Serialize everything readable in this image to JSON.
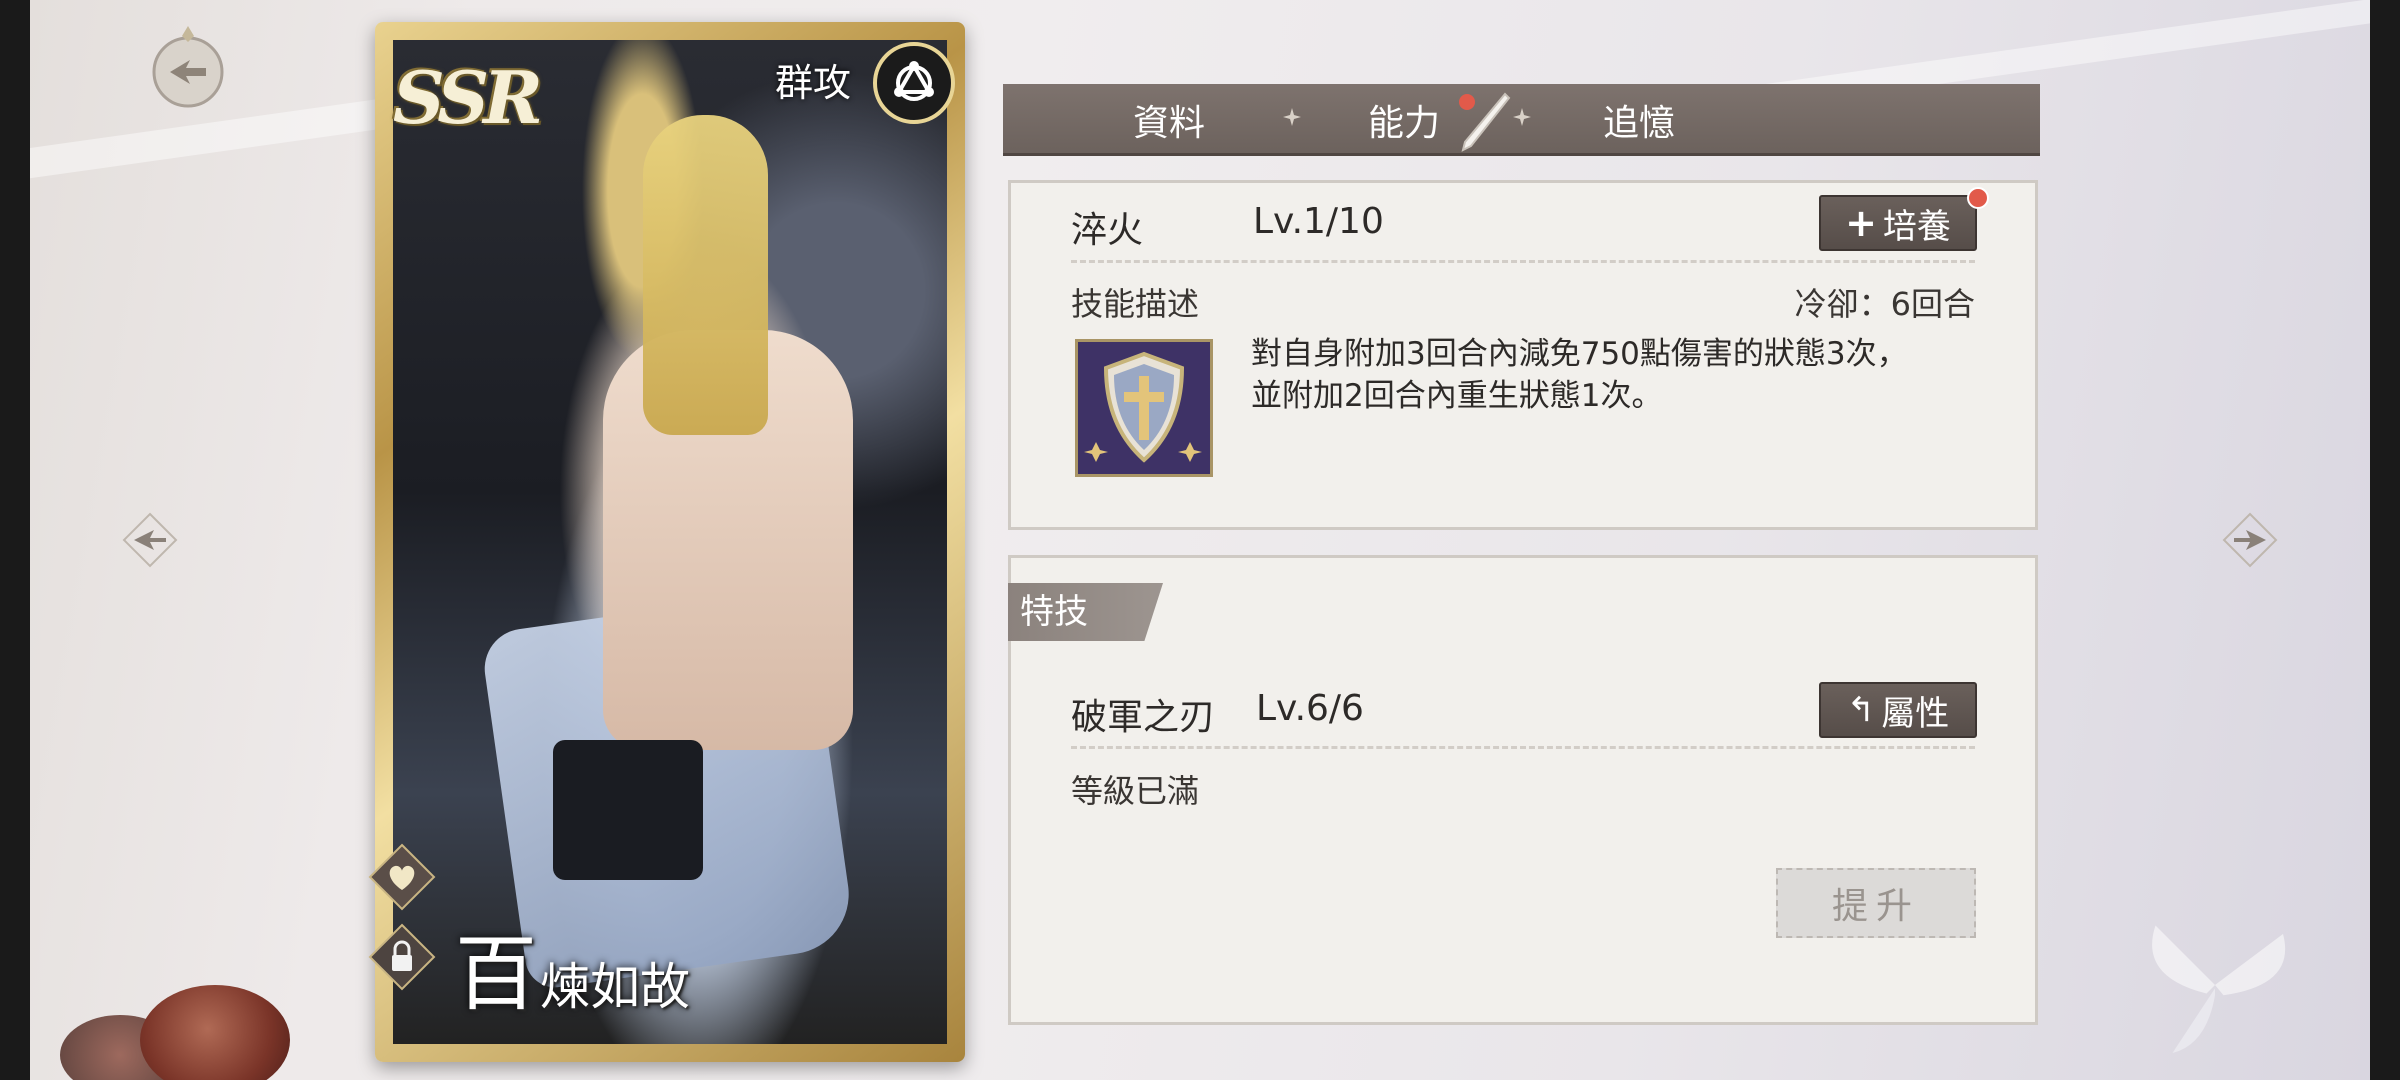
{
  "card": {
    "rarity": "SSR",
    "attack_type": "群攻",
    "name_first": "百",
    "name_rest": "煉如故"
  },
  "tabs": [
    {
      "label": "資料"
    },
    {
      "label": "能力"
    },
    {
      "label": "追憶"
    }
  ],
  "skill": {
    "name": "淬火",
    "level": "Lv.1/10",
    "train_label": "培養",
    "desc_label": "技能描述",
    "cooldown": "冷卻：6回合",
    "description": "對自身附加3回合內減免750點傷害的狀態3次，\n並附加2回合內重生狀態1次。"
  },
  "special": {
    "section_label": "特技",
    "name": "破軍之刃",
    "level": "Lv.6/6",
    "attribute_label": "屬性",
    "status": "等級已滿",
    "upgrade_label": "提升"
  },
  "colors": {
    "tab_bar": "#766b66",
    "button_dark": "#605652",
    "notification_dot": "#e25a4a",
    "card_gold": "#c9a85a"
  }
}
